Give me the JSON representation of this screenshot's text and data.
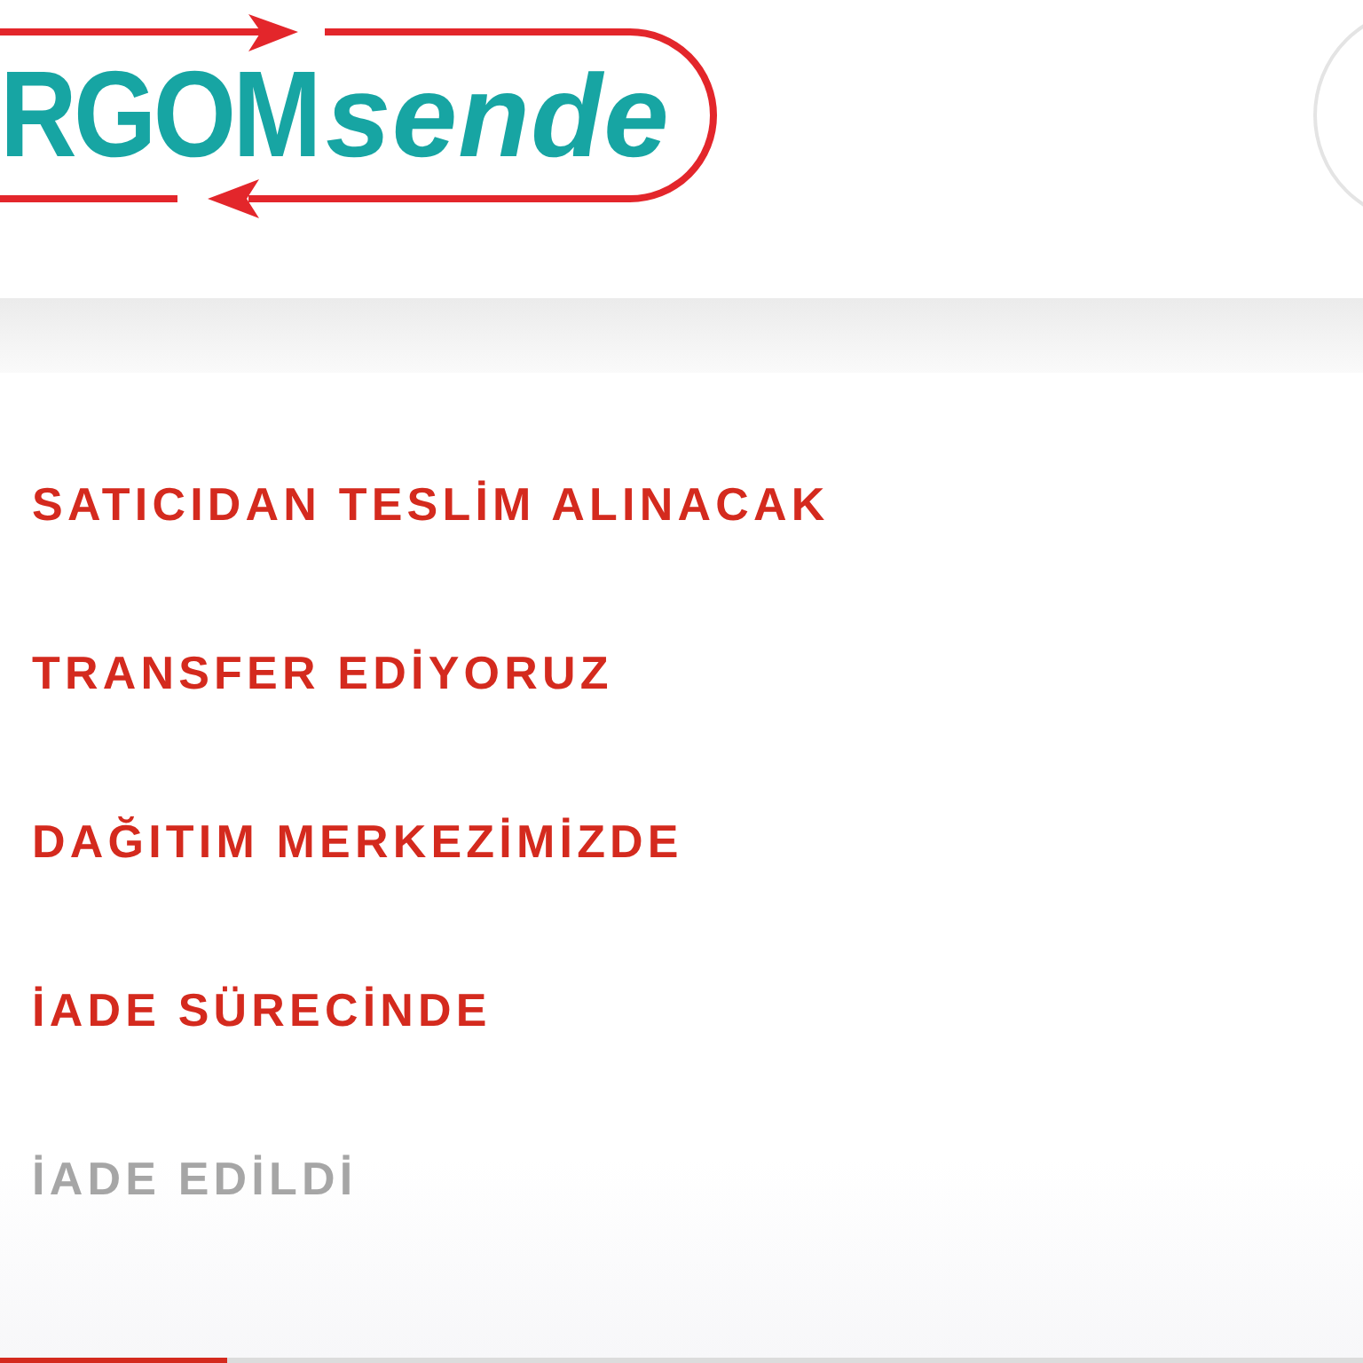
{
  "header": {
    "logo": {
      "part_1": "RGOM",
      "part_2": "sende"
    }
  },
  "statuses": [
    {
      "label": "SATICIDAN TESLİM ALINACAK",
      "reached": true
    },
    {
      "label": "TRANSFER EDİYORUZ",
      "reached": true
    },
    {
      "label": "DAĞITIM MERKEZİMİZDE",
      "reached": true
    },
    {
      "label": "İADE SÜRECİNDE",
      "reached": true
    },
    {
      "label": "İADE EDİLDİ",
      "reached": false
    }
  ],
  "progress": {
    "level": 0.167
  }
}
